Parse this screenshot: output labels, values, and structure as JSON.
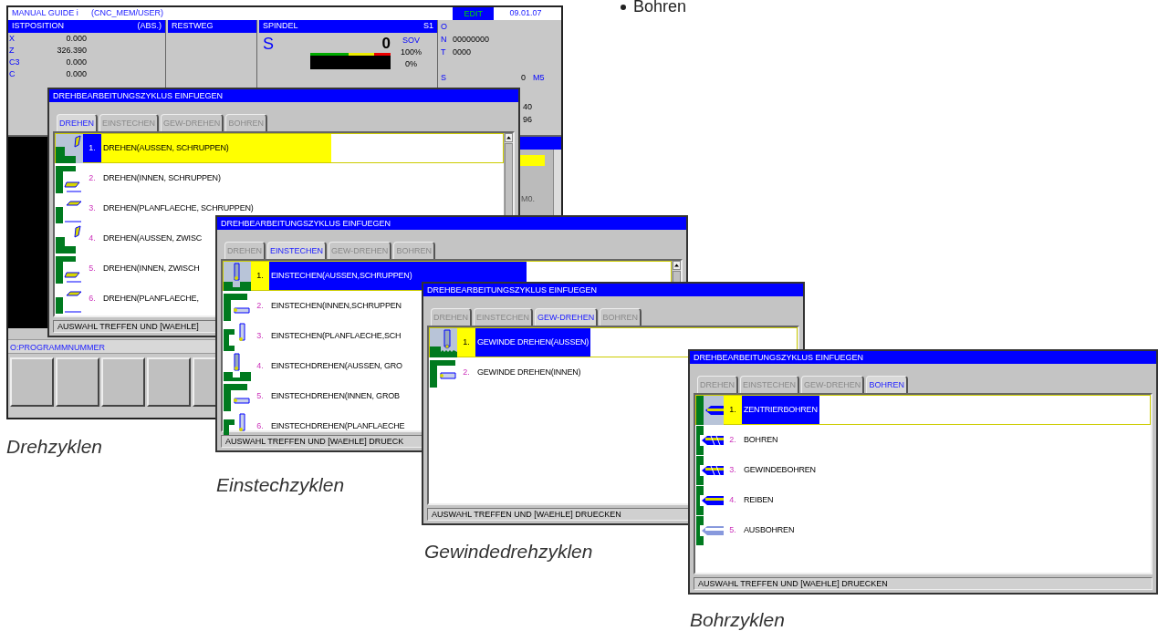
{
  "bullet": {
    "label": "Bohren"
  },
  "main_screen": {
    "title": "MANUAL GUIDE i",
    "path": "(CNC_MEM/USER)",
    "mode": "EDIT",
    "time": "09.01.07",
    "position_panel": {
      "title": "ISTPOSITION",
      "mode": "(ABS.)",
      "axes": [
        {
          "name": "X",
          "value": "0.000"
        },
        {
          "name": "Z",
          "value": "326.390"
        },
        {
          "name": "C3",
          "value": "0.000"
        },
        {
          "name": "C",
          "value": "0.000"
        }
      ]
    },
    "distance_panel": {
      "title": "RESTWEG"
    },
    "spindle_panel": {
      "title": "SPINDEL",
      "channel": "S1",
      "letter": "S",
      "speed": "0",
      "override_label": "SOV",
      "override": "100%",
      "load": "0%"
    },
    "info_panel": {
      "rows": [
        {
          "label": "O"
        },
        {
          "label": "N",
          "value": "00000000"
        },
        {
          "label": "T",
          "value": "0000"
        }
      ],
      "spindle": {
        "label": "S",
        "value": "0",
        "code": "M5"
      },
      "values": [
        "40",
        "96"
      ],
      "faded": "M0."
    },
    "prompt": "O:PROGRAMMNUMMER"
  },
  "dialogs": [
    {
      "title": "DREHBEARBEITUNGSZYKLUS EINFUEGEN",
      "highlight_inverted": true,
      "scrollbar": true,
      "caption": "Drehzyklen",
      "tabs": [
        {
          "label": "DREHEN",
          "selected": true
        },
        {
          "label": "EINSTECHEN",
          "selected": false
        },
        {
          "label": "GEW-DREHEN",
          "selected": false
        },
        {
          "label": "BOHREN",
          "selected": false
        }
      ],
      "items": [
        {
          "number": "1.",
          "label": "DREHEN(AUSSEN, SCHRUPPEN)",
          "selected": true,
          "kind": "turn-outer"
        },
        {
          "number": "2.",
          "label": "DREHEN(INNEN, SCHRUPPEN)",
          "selected": false,
          "kind": "turn-inner"
        },
        {
          "number": "3.",
          "label": "DREHEN(PLANFLAECHE, SCHRUPPEN)",
          "selected": false,
          "kind": "turn-face"
        },
        {
          "number": "4.",
          "label": "DREHEN(AUSSEN, ZWISC",
          "selected": false,
          "kind": "turn-outer"
        },
        {
          "number": "5.",
          "label": "DREHEN(INNEN, ZWISCH",
          "selected": false,
          "kind": "turn-inner"
        },
        {
          "number": "6.",
          "label": "DREHEN(PLANFLAECHE,",
          "selected": false,
          "kind": "turn-face"
        }
      ],
      "status": "AUSWAHL TREFFEN UND [WAEHLE]"
    },
    {
      "title": "DREHBEARBEITUNGSZYKLUS EINFUEGEN",
      "highlight_inverted": false,
      "scrollbar": true,
      "caption": "Einstechzyklen",
      "tabs": [
        {
          "label": "DREHEN",
          "selected": false
        },
        {
          "label": "EINSTECHEN",
          "selected": true
        },
        {
          "label": "GEW-DREHEN",
          "selected": false
        },
        {
          "label": "BOHREN",
          "selected": false
        }
      ],
      "items": [
        {
          "number": "1.",
          "label": "EINSTECHEN(AUSSEN,SCHRUPPEN)",
          "selected": true,
          "kind": "groove-outer"
        },
        {
          "number": "2.",
          "label": "EINSTECHEN(INNEN,SCHRUPPEN",
          "selected": false,
          "kind": "groove-inner"
        },
        {
          "number": "3.",
          "label": "EINSTECHEN(PLANFLAECHE,SCH",
          "selected": false,
          "kind": "groove-face"
        },
        {
          "number": "4.",
          "label": "EINSTECHDREHEN(AUSSEN, GRO",
          "selected": false,
          "kind": "groove-outer"
        },
        {
          "number": "5.",
          "label": "EINSTECHDREHEN(INNEN, GROB",
          "selected": false,
          "kind": "groove-inner"
        },
        {
          "number": "6.",
          "label": "EINSTECHDREHEN(PLANFLAECHE",
          "selected": false,
          "kind": "groove-face"
        }
      ],
      "status": "AUSWAHL TREFFEN UND [WAEHLE] DRUECK"
    },
    {
      "title": "DREHBEARBEITUNGSZYKLUS EINFUEGEN",
      "highlight_inverted": false,
      "scrollbar": false,
      "caption": "Gewindedrehzyklen",
      "tabs": [
        {
          "label": "DREHEN",
          "selected": false
        },
        {
          "label": "EINSTECHEN",
          "selected": false
        },
        {
          "label": "GEW-DREHEN",
          "selected": true
        },
        {
          "label": "BOHREN",
          "selected": false
        }
      ],
      "items": [
        {
          "number": "1.",
          "label": "GEWINDE DREHEN(AUSSEN)",
          "selected": true,
          "kind": "thread-outer"
        },
        {
          "number": "2.",
          "label": "GEWINDE DREHEN(INNEN)",
          "selected": false,
          "kind": "thread-inner"
        }
      ],
      "status": "AUSWAHL TREFFEN UND [WAEHLE] DRUECKEN"
    },
    {
      "title": "DREHBEARBEITUNGSZYKLUS EINFUEGEN",
      "highlight_inverted": false,
      "scrollbar": false,
      "caption": "Bohrzyklen",
      "tabs": [
        {
          "label": "DREHEN",
          "selected": false
        },
        {
          "label": "EINSTECHEN",
          "selected": false
        },
        {
          "label": "GEW-DREHEN",
          "selected": false
        },
        {
          "label": "BOHREN",
          "selected": true
        }
      ],
      "items": [
        {
          "number": "1.",
          "label": "ZENTRIERBOHREN",
          "selected": true,
          "kind": "center-drill"
        },
        {
          "number": "2.",
          "label": "BOHREN",
          "selected": false,
          "kind": "drill"
        },
        {
          "number": "3.",
          "label": "GEWINDEBOHREN",
          "selected": false,
          "kind": "tap"
        },
        {
          "number": "4.",
          "label": "REIBEN",
          "selected": false,
          "kind": "ream"
        },
        {
          "number": "5.",
          "label": "AUSBOHREN",
          "selected": false,
          "kind": "bore"
        }
      ],
      "status": "AUSWAHL TREFFEN UND [WAEHLE] DRUECKEN"
    }
  ]
}
